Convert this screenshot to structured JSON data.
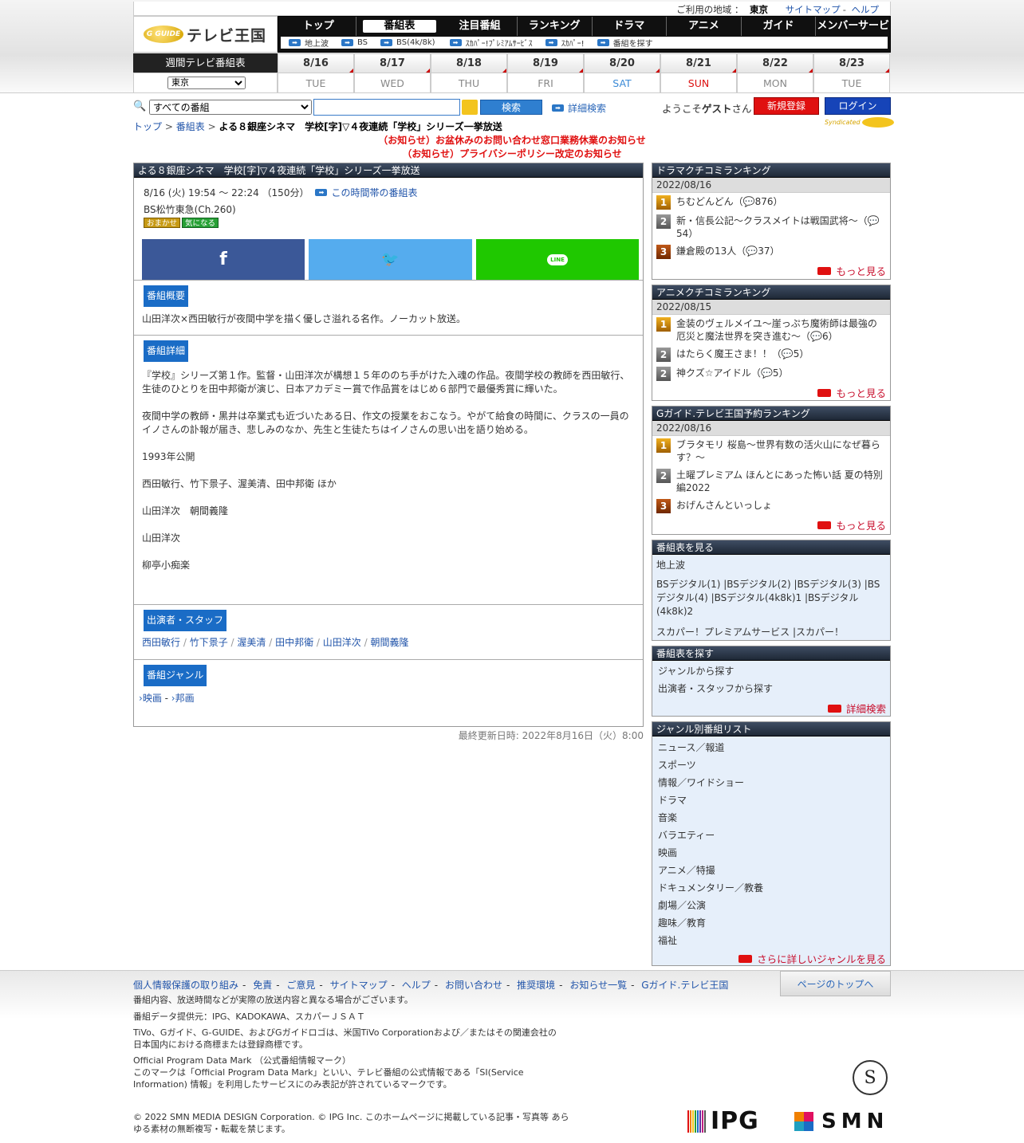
{
  "header": {
    "region_label": "ご利用の地域 ：",
    "region": "東京",
    "sitemap": "サイトマップ",
    "help": "ヘルプ",
    "logo_badge": "G GUIDE",
    "logo_text": "テレビ王国",
    "nav": [
      "トップ",
      "番組表",
      "注目番組",
      "ランキング",
      "ドラマ",
      "アニメ",
      "ガイド",
      "メンバーサービス"
    ],
    "subnav": [
      "地上波",
      "BS",
      "BS(4k/8k)",
      "ｽｶﾊﾟｰ!ﾌﾟﾚﾐｱﾑｻｰﾋﾞｽ",
      "ｽｶﾊﾟｰ!",
      "番組を探す"
    ]
  },
  "week": {
    "label": "週間テレビ番組表",
    "region_select": "東京",
    "days": [
      {
        "d": "8/16",
        "w": "TUE"
      },
      {
        "d": "8/17",
        "w": "WED"
      },
      {
        "d": "8/18",
        "w": "THU"
      },
      {
        "d": "8/19",
        "w": "FRI"
      },
      {
        "d": "8/20",
        "w": "SAT"
      },
      {
        "d": "8/21",
        "w": "SUN"
      },
      {
        "d": "8/22",
        "w": "MON"
      },
      {
        "d": "8/23",
        "w": "TUE"
      }
    ]
  },
  "search": {
    "scope": "すべての番組",
    "button": "検索",
    "advanced": "詳細検索",
    "welcome_pre": "ようこそ",
    "guest": "ゲスト",
    "welcome_post": "さん",
    "register": "新規登録",
    "login": "ログイン"
  },
  "breadcrumb": {
    "top": "トップ",
    "guide": "番組表",
    "sep": ">",
    "current": "よる８銀座シネマ　学校[字]▽４夜連続「学校」シリーズ一挙放送"
  },
  "syndicated": "Syndicated",
  "notices": [
    "（お知らせ）お盆休みのお問い合わせ窓口業務休業のお知らせ",
    "（お知らせ）プライバシーポリシー改定のお知らせ"
  ],
  "program": {
    "title": "よる８銀座シネマ　学校[字]▽４夜連続「学校」シリーズ一挙放送",
    "time": "8/16 (火) 19:54 ～ 22:24 （150分）",
    "time_link": "この時間帯の番組表",
    "channel": "BS松竹東急(Ch.260)",
    "badges": [
      "おまかせ",
      "気になる"
    ],
    "summary_tag": "番組概要",
    "summary": "山田洋次×西田敏行が夜間中学を描く優しさ溢れる名作。ノーカット放送。",
    "detail_tag": "番組詳細",
    "details": [
      "『学校』シリーズ第１作。監督・山田洋次が構想１５年ののち手がけた入魂の作品。夜間学校の教師を西田敏行、生徒のひとりを田中邦衛が演じ、日本アカデミー賞で作品賞をはじめ６部門で最優秀賞に輝いた。",
      "夜間中学の教師・黒井は卒業式も近づいたある日、作文の授業をおこなう。やがて給食の時間に、クラスの一員のイノさんの訃報が届き、悲しみのなか、先生と生徒たちはイノさんの思い出を語り始める。",
      "1993年公開",
      "西田敏行、竹下景子、渥美清、田中邦衛  ほか",
      "山田洋次　朝間義隆",
      "山田洋次",
      "柳亭小痴楽"
    ],
    "cast_tag": "出演者・スタッフ",
    "cast": [
      "西田敏行",
      "竹下景子",
      "渥美清",
      "田中邦衛",
      "山田洋次",
      "朝間義隆"
    ],
    "genre_tag": "番組ジャンル",
    "genres": [
      "映画",
      "邦画"
    ],
    "updated": "最終更新日時: 2022年8月16日（火）8:00"
  },
  "side": {
    "drama": {
      "title": "ドラマクチコミランキング",
      "date": "2022/08/16",
      "items": [
        {
          "t": "ちむどんどん",
          "c": "876"
        },
        {
          "t": "新・信長公記～クラスメイトは戦国武将～",
          "c": "54"
        },
        {
          "t": "鎌倉殿の13人",
          "c": "37"
        }
      ]
    },
    "anime": {
      "title": "アニメクチコミランキング",
      "date": "2022/08/15",
      "items": [
        {
          "t": "金装のヴェルメイユ～崖っぷち魔術師は最強の厄災と魔法世界を突き進む～",
          "c": "6"
        },
        {
          "t": "はたらく魔王さま！！",
          "c": "5"
        },
        {
          "t": "神クズ☆アイドル",
          "c": "5"
        }
      ]
    },
    "reserve": {
      "title": "Gガイド.テレビ王国予約ランキング",
      "date": "2022/08/16",
      "items": [
        "ブラタモリ 桜島〜世界有数の活火山になぜ暮らす？〜",
        "土曜プレミアム ほんとにあった怖い話 夏の特別編2022",
        "おげんさんといっしょ"
      ]
    },
    "more": "もっと見る",
    "guide": {
      "title": "番組表を見る",
      "terrestrial": "地上波",
      "bs": "BSデジタル(1) |BSデジタル(2) |BSデジタル(3) |BSデジタル(4) |BSデジタル(4k8k)1 |BSデジタル(4k8k)2",
      "skp": "スカパー！プレミアムサービス |スカパー！"
    },
    "find": {
      "title": "番組表を探す",
      "items": [
        "ジャンルから探す",
        "出演者・スタッフから探す"
      ],
      "adv": "詳細検索"
    },
    "genre": {
      "title": "ジャンル別番組リスト",
      "items": [
        "ニュース／報道",
        "スポーツ",
        "情報／ワイドショー",
        "ドラマ",
        "音楽",
        "バラエティー",
        "映画",
        "アニメ／特撮",
        "ドキュメンタリー／教養",
        "劇場／公演",
        "趣味／教育",
        "福祉"
      ],
      "more": "さらに詳しいジャンルを見る"
    }
  },
  "footer": {
    "links": [
      "個人情報保護の取り組み",
      "免責",
      "ご意見",
      "サイトマップ",
      "ヘルプ",
      "お問い合わせ",
      "推奨環境",
      "お知らせ一覧",
      "Gガイド.テレビ王国"
    ],
    "link_sep": "-",
    "top": "ページのトップへ",
    "disclaimer": "番組内容、放送時間などが実際の放送内容と異なる場合がございます。",
    "provider": "番組データ提供元：IPG、KADOKAWA、スカパーＪＳＡＴ",
    "tm1": "TiVo、Gガイド、G-GUIDE、およびGガイドロゴは、米国TiVo Corporationおよび／またはその関連会社の",
    "tm2": "日本国内における商標または登録商標です。",
    "opdm1": "Official Program Data Mark （公式番組情報マーク）",
    "opdm2": "このマークは「Official Program Data Mark」といい、テレビ番組の公式情報である「SI(Service",
    "opdm3": "Information) 情報」を利用したサービスにのみ表記が許されているマークです。",
    "copy1": "© 2022 SMN MEDIA DESIGN Corporation. © IPG Inc. このホームページに掲載している記事・写真等 あら",
    "copy2": "ゆる素材の無断複写・転載を禁じます。",
    "logo_ipg": "IPG",
    "logo_smn": "SMN",
    "seal": "S"
  }
}
